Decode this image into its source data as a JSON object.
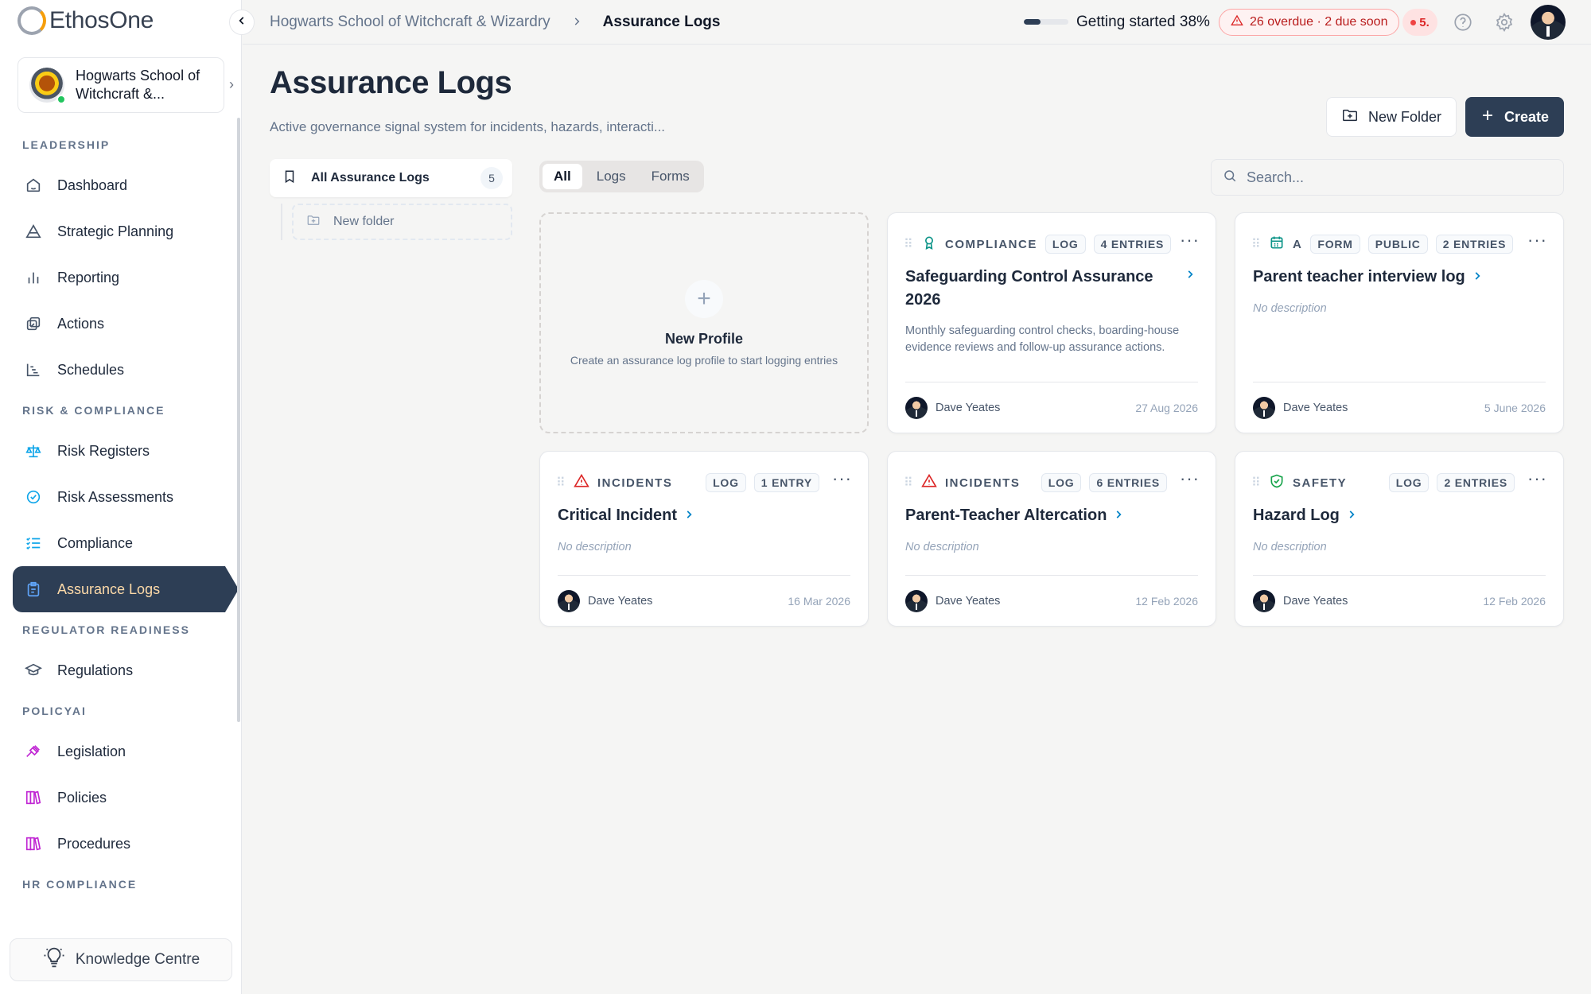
{
  "app": {
    "logo_text": "EthosOne",
    "org_name": "Hogwarts School of Witchcraft &...",
    "knowledge_label": "Knowledge Centre"
  },
  "sidebar": {
    "sections": [
      {
        "title": "LEADERSHIP",
        "items": [
          {
            "label": "Dashboard",
            "icon": "home-icon"
          },
          {
            "label": "Strategic Planning",
            "icon": "triangle-icon"
          },
          {
            "label": "Reporting",
            "icon": "bar-chart-icon"
          },
          {
            "label": "Actions",
            "icon": "actions-icon"
          },
          {
            "label": "Schedules",
            "icon": "schedule-chart-icon"
          }
        ]
      },
      {
        "title": "RISK & COMPLIANCE",
        "items": [
          {
            "label": "Risk Registers",
            "icon": "scale-icon"
          },
          {
            "label": "Risk Assessments",
            "icon": "check-circle-icon"
          },
          {
            "label": "Compliance",
            "icon": "checklist-icon"
          },
          {
            "label": "Assurance Logs",
            "icon": "clipboard-icon",
            "active": true
          }
        ]
      },
      {
        "title": "REGULATOR READINESS",
        "items": [
          {
            "label": "Regulations",
            "icon": "graduation-cap-icon"
          }
        ]
      },
      {
        "title": "POLICYAI",
        "items": [
          {
            "label": "Legislation",
            "icon": "gavel-icon"
          },
          {
            "label": "Policies",
            "icon": "books-icon"
          },
          {
            "label": "Procedures",
            "icon": "books-icon"
          }
        ]
      },
      {
        "title": "HR COMPLIANCE",
        "items": []
      }
    ]
  },
  "topbar": {
    "breadcrumb_org": "Hogwarts School of Witchcraft & Wizardry",
    "breadcrumb_current": "Assurance Logs",
    "progress_label": "Getting started 38%",
    "progress_value": 0.38,
    "overdue_text": "26 overdue · 2 due soon",
    "notification_text": "5."
  },
  "page": {
    "title": "Assurance Logs",
    "subtitle": "Active governance signal system for incidents, hazards, interacti...",
    "new_folder_label": "New Folder",
    "create_label": "Create"
  },
  "folders": {
    "all_label": "All Assurance Logs",
    "all_count": "5",
    "new_folder_label": "New folder"
  },
  "tabs": [
    "All",
    "Logs",
    "Forms"
  ],
  "search": {
    "placeholder": "Search..."
  },
  "new_profile": {
    "title": "New Profile",
    "subtitle": "Create an assurance log profile to start logging entries"
  },
  "cards": [
    {
      "category": "COMPLIANCE",
      "category_icon": "award-icon",
      "type": "LOG",
      "entries": "4 ENTRIES",
      "title": "Safeguarding Control Assurance 2026",
      "description": "Monthly safeguarding control checks, boarding-house evidence reviews and follow-up assurance actions.",
      "author": "Dave Yeates",
      "date": "27 Aug 2026"
    },
    {
      "category": "A",
      "category_icon": "calendar-icon",
      "type": "FORM",
      "visibility": "PUBLIC",
      "entries": "2 ENTRIES",
      "title": "Parent teacher interview log",
      "description": "No description",
      "author": "Dave Yeates",
      "date": "5 June 2026"
    },
    {
      "category": "INCIDENTS",
      "category_icon": "warning-icon",
      "type": "LOG",
      "entries": "1 ENTRY",
      "title": "Critical Incident",
      "description": "No description",
      "author": "Dave Yeates",
      "date": "16 Mar 2026"
    },
    {
      "category": "INCIDENTS",
      "category_icon": "warning-icon",
      "type": "LOG",
      "entries": "6 ENTRIES",
      "title": "Parent-Teacher Altercation",
      "description": "No description",
      "author": "Dave Yeates",
      "date": "12 Feb 2026"
    },
    {
      "category": "SAFETY",
      "category_icon": "shield-check-icon",
      "type": "LOG",
      "entries": "2 ENTRIES",
      "title": "Hazard Log",
      "description": "No description",
      "author": "Dave Yeates",
      "date": "12 Feb 2026"
    }
  ],
  "colors": {
    "primary": "#2d3e55",
    "active_text": "#fcd9a8",
    "danger": "#dc2626",
    "compliance_icon": "#0d9488",
    "form_icon": "#0d9488",
    "safety_icon": "#16a34a",
    "link_chevron": "#0284c7"
  }
}
